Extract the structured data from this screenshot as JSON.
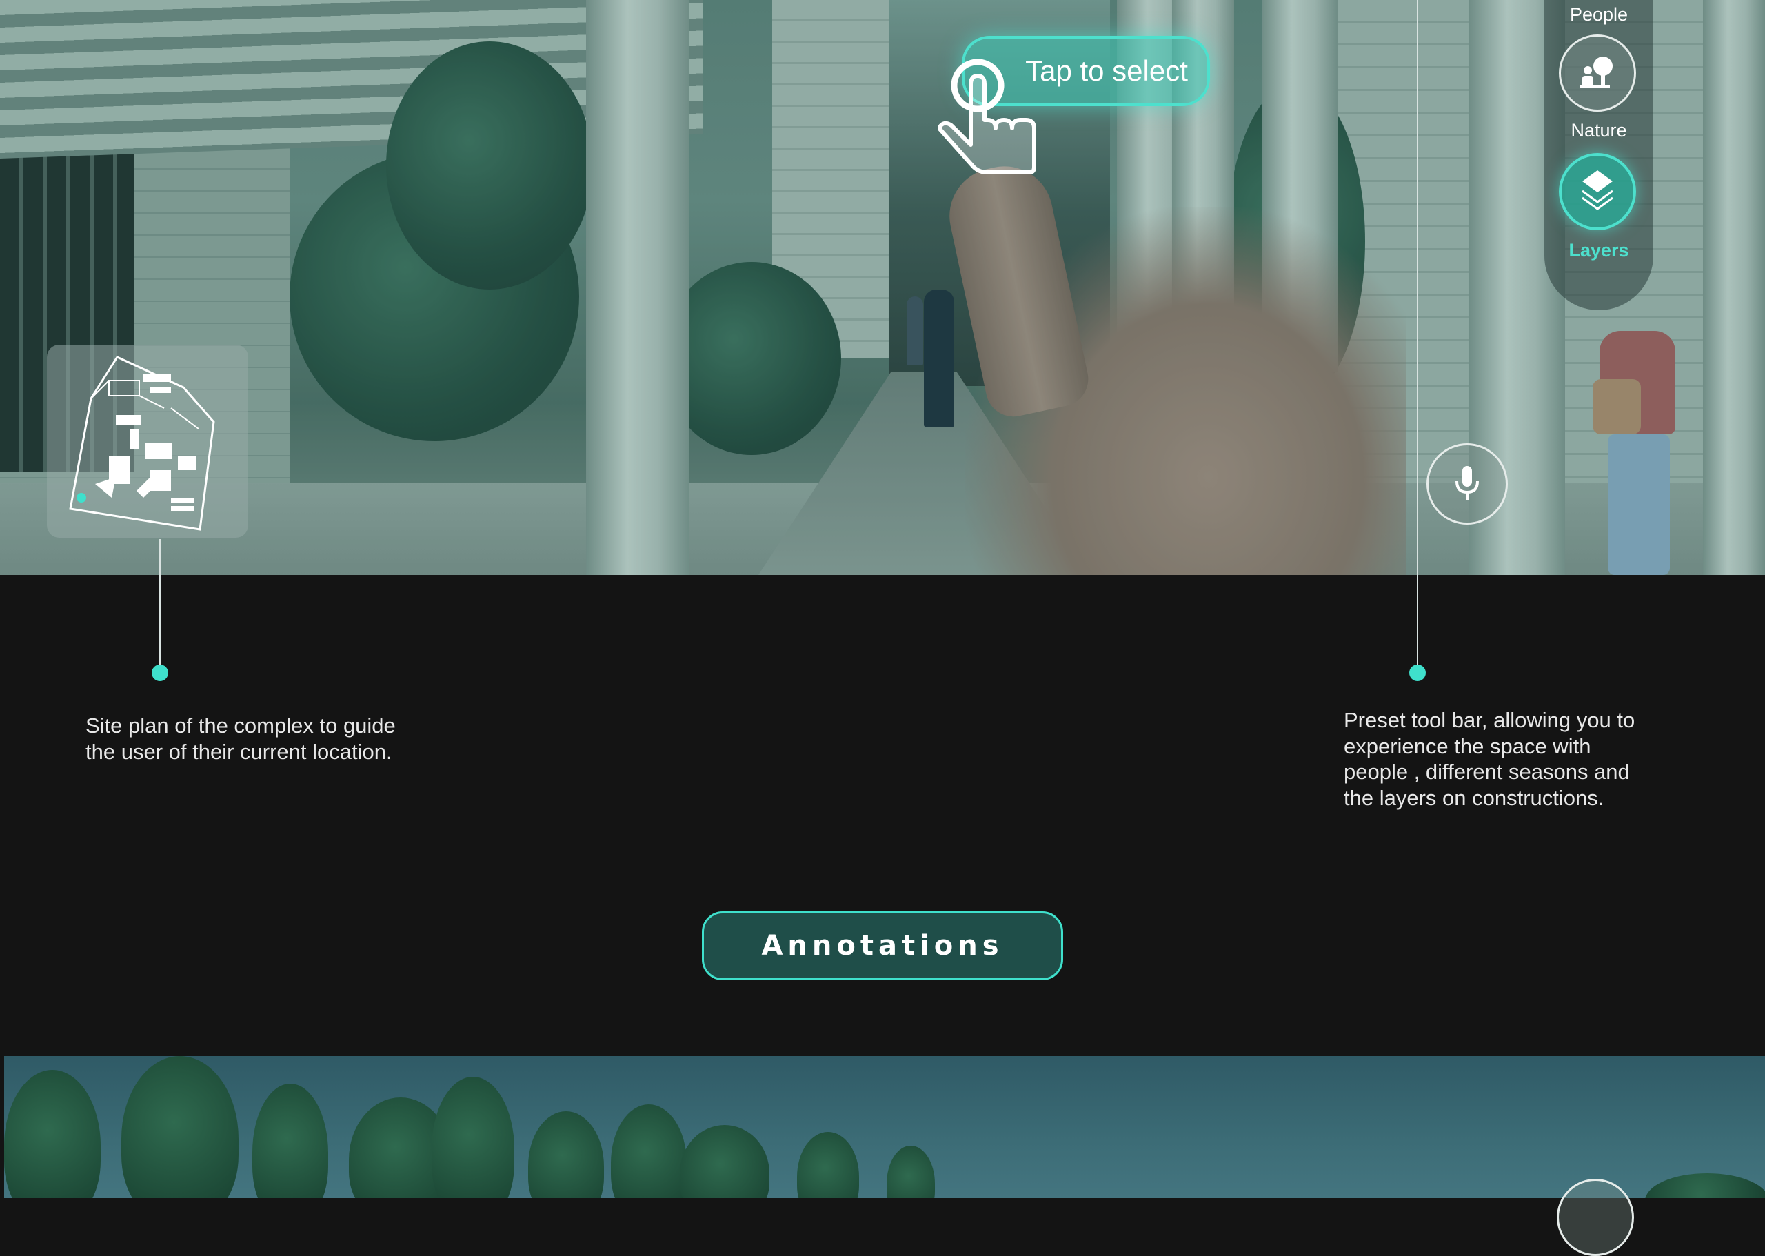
{
  "tap_prompt": {
    "label": "Tap to select"
  },
  "toolbar": {
    "items": [
      {
        "label": "People",
        "icon": "people-icon",
        "active": false
      },
      {
        "label": "Nature",
        "icon": "nature-icon",
        "active": false
      },
      {
        "label": "Layers",
        "icon": "layers-icon",
        "active": true
      }
    ]
  },
  "mic": {
    "icon": "microphone-icon"
  },
  "minimap": {
    "icon": "site-plan-map"
  },
  "captions": {
    "site_plan": "Site plan of the complex to guide the user of their current location.",
    "toolbar": "Preset tool bar, allowing you to experience the space with people , different seasons and the layers on constructions."
  },
  "annotations_button": {
    "label": "Annotations"
  },
  "colors": {
    "accent": "#3fe0cc",
    "background": "#141414",
    "button_fill": "#1f4e49",
    "caption_text": "#e8e8e8"
  }
}
